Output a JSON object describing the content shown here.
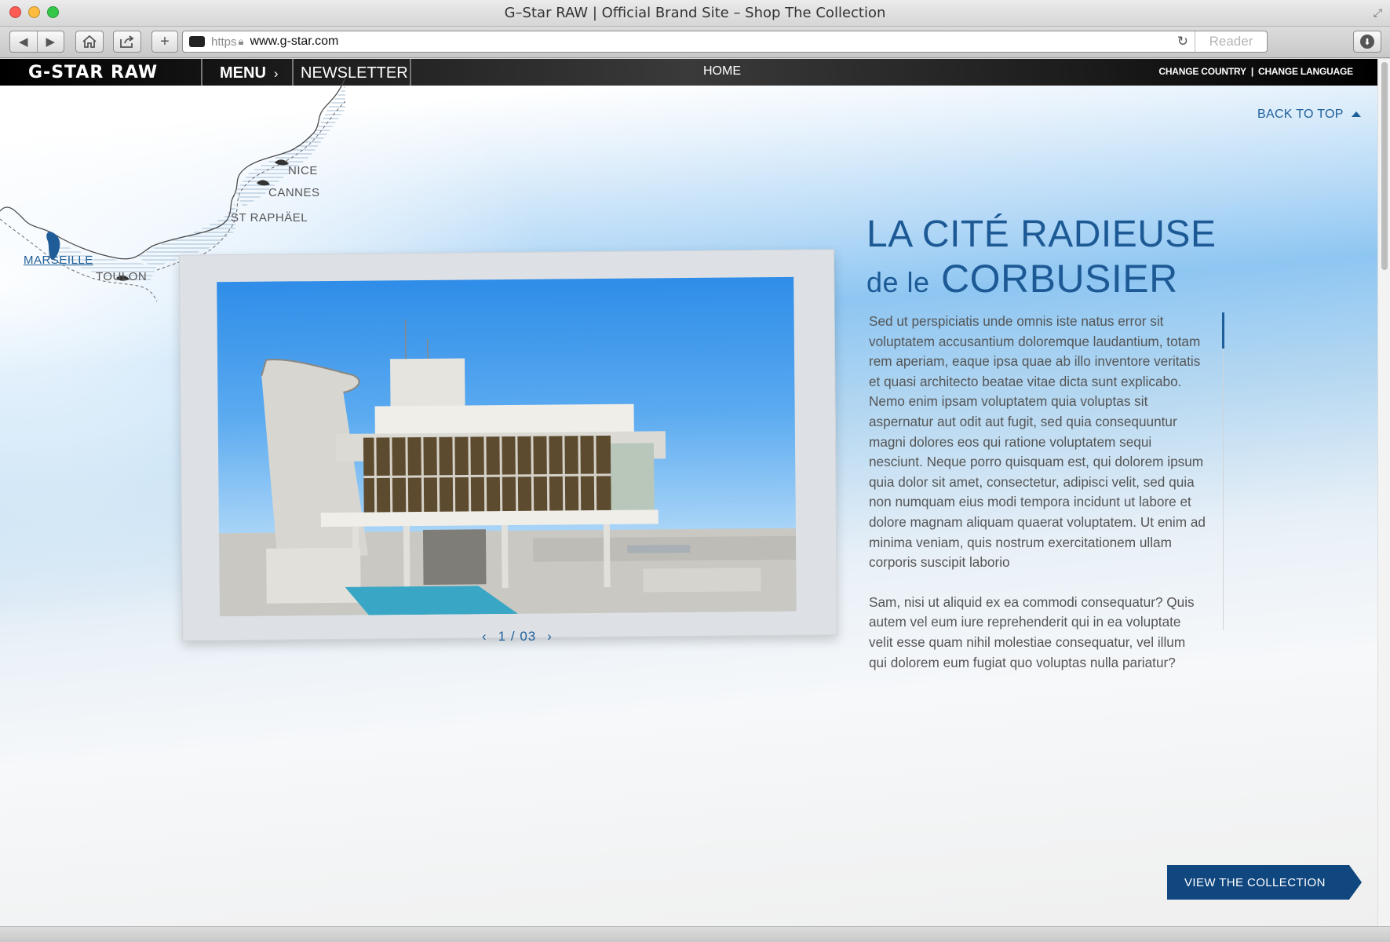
{
  "browser": {
    "window_title": "G–Star RAW | Official Brand Site – Shop The Collection",
    "url_scheme": "https",
    "url": "www.g-star.com",
    "reader_label": "Reader"
  },
  "site_nav": {
    "logo": "G-STAR RAW",
    "menu_label": "MENU",
    "newsletter_label": "NEWSLETTER",
    "home_label": "HOME",
    "change_country": "CHANGE COUNTRY",
    "separator": "|",
    "change_language": "CHANGE LANGUAGE"
  },
  "back_to_top": "BACK TO TOP",
  "map": {
    "cities": [
      "NICE",
      "CANNES",
      "ST RAPHÄEL",
      "MARSEILLE",
      "TOULON"
    ],
    "active_city": "MARSEILLE"
  },
  "article": {
    "title_line1": "LA CITÉ RADIEUSE",
    "title_line2_prefix": "de le",
    "title_line2_main": "CORBUSIER",
    "paragraphs": [
      "Sed ut perspiciatis unde omnis iste natus error sit voluptatem accusantium doloremque laudantium, totam rem aperiam, eaque ipsa quae ab illo inventore veritatis et quasi architecto beatae vitae dicta sunt explicabo. Nemo enim ipsam voluptatem quia voluptas sit aspernatur aut odit aut fugit, sed quia consequuntur magni dolores eos qui ratione voluptatem sequi nesciunt. Neque porro quisquam est, qui dolorem ipsum quia dolor sit amet, consectetur, adipisci velit, sed quia non numquam eius modi tempora incidunt ut labore et dolore magnam aliquam quaerat voluptatem. Ut enim ad minima veniam, quis nostrum exercitationem ullam corporis suscipit laborio",
      "Sam, nisi ut aliquid ex ea commodi consequatur? Quis autem vel eum iure reprehenderit qui in ea voluptate velit esse quam nihil molestiae consequatur, vel illum qui dolorem eum fugiat quo voluptas nulla pariatur?"
    ]
  },
  "slider": {
    "current": "1",
    "separator": "/",
    "total": "03",
    "prev_icon": "chevron-left-icon",
    "next_icon": "chevron-right-icon"
  },
  "cta_label": "VIEW THE COLLECTION",
  "colors": {
    "accent": "#1e5f9a",
    "cta": "#11477f",
    "sky": "#8ec6f2"
  }
}
